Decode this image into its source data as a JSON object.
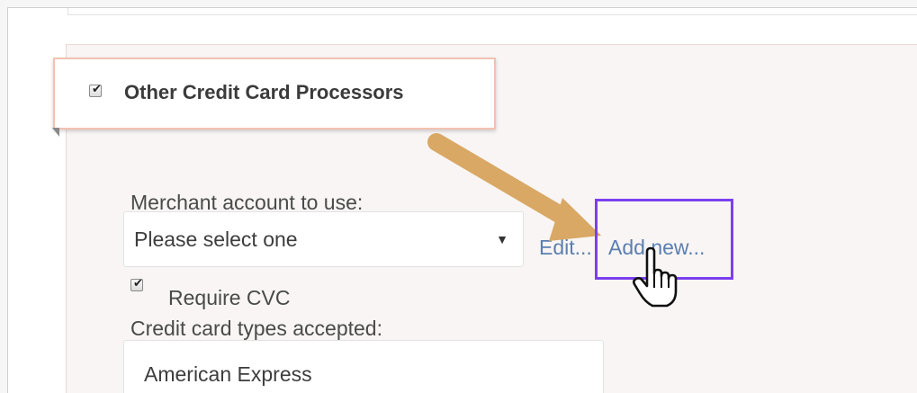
{
  "section": {
    "title": "Other Credit Card Processors",
    "enabled": true
  },
  "merchant": {
    "label": "Merchant account to use:",
    "select_value": "Please select one",
    "edit_link": "Edit...",
    "add_new_link": "Add new..."
  },
  "cvc": {
    "label": "Require CVC",
    "checked": true
  },
  "card_types": {
    "label": "Credit card types accepted:",
    "items": [
      "American Express"
    ]
  },
  "annotation": {
    "arrow_color": "#d9a865",
    "highlight_color": "#7b3ff0"
  },
  "icons": {
    "checkbox_mark": "✔",
    "select_caret": "▼",
    "cursor": "hand-pointer-icon"
  }
}
